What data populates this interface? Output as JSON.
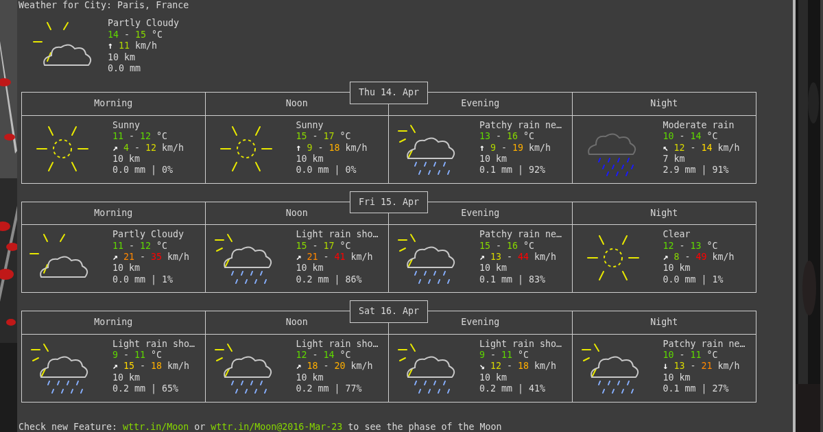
{
  "title": "Weather for City: Paris, France",
  "current": {
    "kind": "partly_cloudy",
    "condition": "Partly Cloudy",
    "temp": [
      {
        "text": "14",
        "color": "#5fd700"
      },
      {
        "text": " - "
      },
      {
        "text": "15",
        "color": "#87d700"
      },
      {
        "text": " °C"
      }
    ],
    "wind": [
      {
        "text": "↑ ",
        "kind": "arrow"
      },
      {
        "text": "11",
        "color": "#afd700"
      },
      {
        "text": " km/h"
      }
    ],
    "visibility": "10 km",
    "precipitation": "0.0 mm"
  },
  "days": [
    {
      "date": "Thu 14. Apr",
      "columns": [
        "Morning",
        "Noon",
        "Evening",
        "Night"
      ],
      "periods": [
        {
          "kind": "sunny",
          "condition": "Sunny",
          "temp": [
            {
              "text": "11",
              "color": "#5fd700"
            },
            {
              "text": " - "
            },
            {
              "text": "12",
              "color": "#5fd700"
            },
            {
              "text": " °C"
            }
          ],
          "wind": [
            {
              "text": "↗ ",
              "kind": "arrow"
            },
            {
              "text": "4",
              "color": "#87d700"
            },
            {
              "text": " - "
            },
            {
              "text": "12",
              "color": "#d7d700"
            },
            {
              "text": " km/h"
            }
          ],
          "visibility": "10 km",
          "precipitation": "0.0 mm | 0%"
        },
        {
          "kind": "sunny",
          "condition": "Sunny",
          "temp": [
            {
              "text": "15",
              "color": "#87d700"
            },
            {
              "text": " - "
            },
            {
              "text": "17",
              "color": "#afd700"
            },
            {
              "text": " °C"
            }
          ],
          "wind": [
            {
              "text": "↑ ",
              "kind": "arrow"
            },
            {
              "text": "9",
              "color": "#afd700"
            },
            {
              "text": " - "
            },
            {
              "text": "18",
              "color": "#ffaf00"
            },
            {
              "text": " km/h"
            }
          ],
          "visibility": "10 km",
          "precipitation": "0.0 mm | 0%"
        },
        {
          "kind": "sun_shower",
          "condition": "Patchy rain ne…",
          "temp": [
            {
              "text": "13",
              "color": "#5fd700"
            },
            {
              "text": " - "
            },
            {
              "text": "16",
              "color": "#87d700"
            },
            {
              "text": " °C"
            }
          ],
          "wind": [
            {
              "text": "↑ ",
              "kind": "arrow"
            },
            {
              "text": "9",
              "color": "#afd700"
            },
            {
              "text": " - "
            },
            {
              "text": "19",
              "color": "#ffaf00"
            },
            {
              "text": " km/h"
            }
          ],
          "visibility": "10 km",
          "precipitation": "0.1 mm | 92%"
        },
        {
          "kind": "heavy_rain",
          "condition": "Moderate rain",
          "temp": [
            {
              "text": "10",
              "color": "#5fd700"
            },
            {
              "text": " - "
            },
            {
              "text": "14",
              "color": "#5fd700"
            },
            {
              "text": " °C"
            }
          ],
          "wind": [
            {
              "text": "↖ ",
              "kind": "arrow"
            },
            {
              "text": "12",
              "color": "#d7d700"
            },
            {
              "text": " - "
            },
            {
              "text": "14",
              "color": "#ffd700"
            },
            {
              "text": " km/h"
            }
          ],
          "visibility": "7 km",
          "precipitation": "2.9 mm | 91%"
        }
      ]
    },
    {
      "date": "Fri 15. Apr",
      "columns": [
        "Morning",
        "Noon",
        "Evening",
        "Night"
      ],
      "periods": [
        {
          "kind": "partly_cloudy",
          "condition": "Partly Cloudy",
          "temp": [
            {
              "text": "11",
              "color": "#5fd700"
            },
            {
              "text": " - "
            },
            {
              "text": "12",
              "color": "#5fd700"
            },
            {
              "text": " °C"
            }
          ],
          "wind": [
            {
              "text": "↗ ",
              "kind": "arrow"
            },
            {
              "text": "21",
              "color": "#ff8700"
            },
            {
              "text": " - "
            },
            {
              "text": "35",
              "color": "#ff0000"
            },
            {
              "text": " km/h"
            }
          ],
          "visibility": "10 km",
          "precipitation": "0.0 mm | 1%"
        },
        {
          "kind": "sun_shower",
          "condition": "Light rain sho…",
          "temp": [
            {
              "text": "15",
              "color": "#87d700"
            },
            {
              "text": " - "
            },
            {
              "text": "17",
              "color": "#afd700"
            },
            {
              "text": " °C"
            }
          ],
          "wind": [
            {
              "text": "↗ ",
              "kind": "arrow"
            },
            {
              "text": "21",
              "color": "#ff8700"
            },
            {
              "text": " - "
            },
            {
              "text": "41",
              "color": "#ff0000"
            },
            {
              "text": " km/h"
            }
          ],
          "visibility": "10 km",
          "precipitation": "0.2 mm | 86%"
        },
        {
          "kind": "sun_shower",
          "condition": "Patchy rain ne…",
          "temp": [
            {
              "text": "15",
              "color": "#87d700"
            },
            {
              "text": " - "
            },
            {
              "text": "16",
              "color": "#87d700"
            },
            {
              "text": " °C"
            }
          ],
          "wind": [
            {
              "text": "↗ ",
              "kind": "arrow"
            },
            {
              "text": "13",
              "color": "#d7d700"
            },
            {
              "text": " - "
            },
            {
              "text": "44",
              "color": "#ff0000"
            },
            {
              "text": " km/h"
            }
          ],
          "visibility": "10 km",
          "precipitation": "0.1 mm | 83%"
        },
        {
          "kind": "sunny",
          "condition": "Clear",
          "temp": [
            {
              "text": "12",
              "color": "#5fd700"
            },
            {
              "text": " - "
            },
            {
              "text": "13",
              "color": "#5fd700"
            },
            {
              "text": " °C"
            }
          ],
          "wind": [
            {
              "text": "↗ ",
              "kind": "arrow"
            },
            {
              "text": "8",
              "color": "#87d700"
            },
            {
              "text": " - "
            },
            {
              "text": "49",
              "color": "#ff0000"
            },
            {
              "text": " km/h"
            }
          ],
          "visibility": "10 km",
          "precipitation": "0.0 mm | 1%"
        }
      ]
    },
    {
      "date": "Sat 16. Apr",
      "columns": [
        "Morning",
        "Noon",
        "Evening",
        "Night"
      ],
      "periods": [
        {
          "kind": "sun_shower",
          "condition": "Light rain sho…",
          "temp": [
            {
              "text": "9",
              "color": "#5fd700"
            },
            {
              "text": " - "
            },
            {
              "text": "11",
              "color": "#5fd700"
            },
            {
              "text": " °C"
            }
          ],
          "wind": [
            {
              "text": "↗ ",
              "kind": "arrow"
            },
            {
              "text": "15",
              "color": "#ffd700"
            },
            {
              "text": " - "
            },
            {
              "text": "18",
              "color": "#ffaf00"
            },
            {
              "text": " km/h"
            }
          ],
          "visibility": "10 km",
          "precipitation": "0.2 mm | 65%"
        },
        {
          "kind": "sun_shower",
          "condition": "Light rain sho…",
          "temp": [
            {
              "text": "12",
              "color": "#5fd700"
            },
            {
              "text": " - "
            },
            {
              "text": "14",
              "color": "#5fd700"
            },
            {
              "text": " °C"
            }
          ],
          "wind": [
            {
              "text": "↗ ",
              "kind": "arrow"
            },
            {
              "text": "18",
              "color": "#ffaf00"
            },
            {
              "text": " - "
            },
            {
              "text": "20",
              "color": "#ffaf00"
            },
            {
              "text": " km/h"
            }
          ],
          "visibility": "10 km",
          "precipitation": "0.2 mm | 77%"
        },
        {
          "kind": "sun_shower",
          "condition": "Light rain sho…",
          "temp": [
            {
              "text": "9",
              "color": "#5fd700"
            },
            {
              "text": " - "
            },
            {
              "text": "11",
              "color": "#5fd700"
            },
            {
              "text": " °C"
            }
          ],
          "wind": [
            {
              "text": "↘ ",
              "kind": "arrow"
            },
            {
              "text": "12",
              "color": "#d7d700"
            },
            {
              "text": " - "
            },
            {
              "text": "18",
              "color": "#ffaf00"
            },
            {
              "text": " km/h"
            }
          ],
          "visibility": "10 km",
          "precipitation": "0.2 mm | 41%"
        },
        {
          "kind": "sun_shower",
          "condition": "Patchy rain ne…",
          "temp": [
            {
              "text": "10",
              "color": "#5fd700"
            },
            {
              "text": " - "
            },
            {
              "text": "11",
              "color": "#5fd700"
            },
            {
              "text": " °C"
            }
          ],
          "wind": [
            {
              "text": "↓ ",
              "kind": "arrow"
            },
            {
              "text": "13",
              "color": "#d7d700"
            },
            {
              "text": " - "
            },
            {
              "text": "21",
              "color": "#ff8700"
            },
            {
              "text": " km/h"
            }
          ],
          "visibility": "10 km",
          "precipitation": "0.1 mm | 27%"
        }
      ]
    }
  ],
  "footer": [
    {
      "kind": "text",
      "text": "Check new Feature: "
    },
    {
      "kind": "link",
      "text": "wttr.in/Moon"
    },
    {
      "kind": "text",
      "text": " or "
    },
    {
      "kind": "link",
      "text": "wttr.in/Moon@2016-Mar-23"
    },
    {
      "kind": "text",
      "text": " to see the phase of the Moon"
    }
  ]
}
